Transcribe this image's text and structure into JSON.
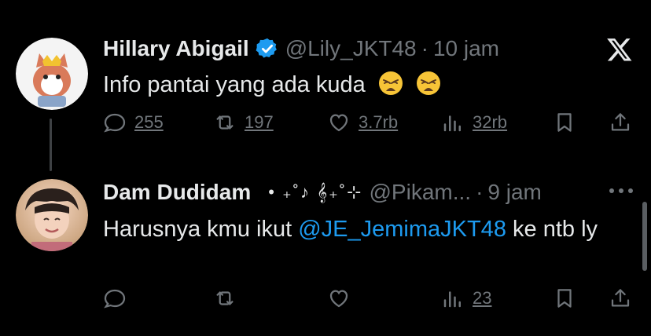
{
  "tweets": [
    {
      "display_name": "Hillary Abigail",
      "handle": "@Lily_JKT48",
      "time": "10 jam",
      "text": "Info pantai yang ada kuda",
      "actions": {
        "reply": "255",
        "retweet": "197",
        "like": "3.7rb",
        "views": "32rb"
      }
    },
    {
      "display_name": "Dam Dudidam",
      "deco": "• ₊˚♪ 𝄞₊˚⊹",
      "handle": "@Pikam...",
      "time": "9 jam",
      "text_before": "Harusnya kmu ikut ",
      "mention": "@JE_JemimaJKT48",
      "text_after": " ke ntb ly",
      "actions": {
        "views": "23"
      }
    }
  ],
  "separator": "·",
  "icons": [
    "x-logo-icon",
    "verified-badge-icon",
    "reply-icon",
    "retweet-icon",
    "like-icon",
    "views-icon",
    "bookmark-icon",
    "share-icon",
    "more-icon",
    "weary-face-emoji"
  ],
  "colors": {
    "background": "#000000",
    "text": "#e7e9ea",
    "muted": "#71767b",
    "link": "#1d9bf0",
    "verified": "#1d9bf0"
  }
}
